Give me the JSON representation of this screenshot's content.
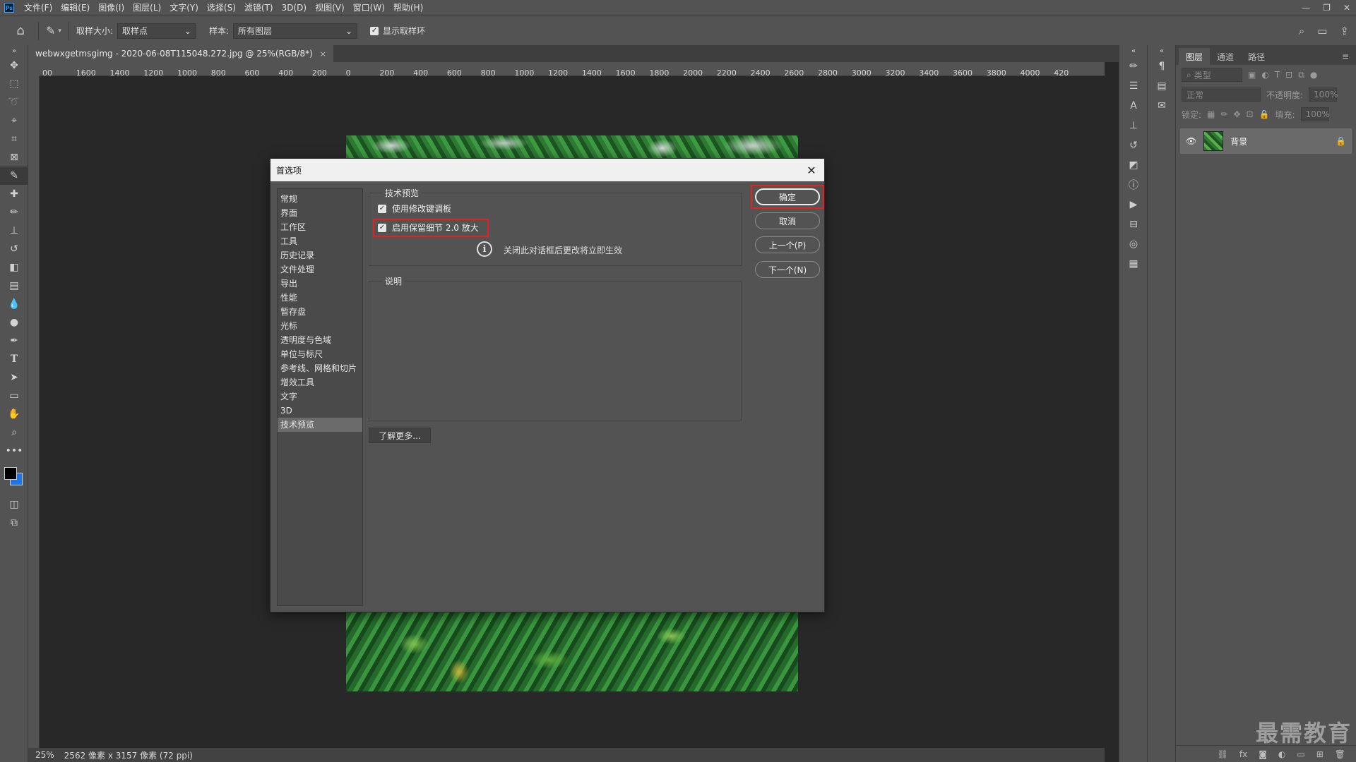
{
  "app": {
    "logo": "Ps"
  },
  "menu": [
    "文件(F)",
    "编辑(E)",
    "图像(I)",
    "图层(L)",
    "文字(Y)",
    "选择(S)",
    "滤镜(T)",
    "3D(D)",
    "视图(V)",
    "窗口(W)",
    "帮助(H)"
  ],
  "options": {
    "sample_size_label": "取样大小:",
    "sample_size_value": "取样点",
    "sample_label": "样本:",
    "sample_value": "所有图层",
    "show_ring_label": "显示取样环",
    "show_ring_checked": true
  },
  "document": {
    "tab_title": "webwxgetmsgimg - 2020-06-08T115048.272.jpg @ 25%(RGB/8*)",
    "ruler_ticks": [
      "00",
      "1600",
      "1400",
      "1200",
      "1000",
      "800",
      "600",
      "400",
      "200",
      "0",
      "200",
      "400",
      "600",
      "800",
      "1000",
      "1200",
      "1400",
      "1600",
      "1800",
      "2000",
      "2200",
      "2400",
      "2600",
      "2800",
      "3000",
      "3200",
      "3400",
      "3600",
      "3800",
      "4000",
      "420"
    ]
  },
  "status": {
    "zoom": "25%",
    "size": "2562 像素 x 3157 像素 (72 ppi)"
  },
  "layers_panel": {
    "tabs": [
      "图层",
      "通道",
      "路径"
    ],
    "filter_placeholder": "类型",
    "blend_mode": "正常",
    "opacity_label": "不透明度:",
    "opacity_value": "100%",
    "lock_label": "锁定:",
    "fill_label": "填充:",
    "fill_value": "100%",
    "layer_name": "背景"
  },
  "watermark": "最需教育",
  "dialog": {
    "title": "首选项",
    "nav": [
      "常规",
      "界面",
      "工作区",
      "工具",
      "历史记录",
      "文件处理",
      "导出",
      "性能",
      "暂存盘",
      "光标",
      "透明度与色域",
      "单位与标尺",
      "参考线、网格和切片",
      "增效工具",
      "文字",
      "3D",
      "技术预览"
    ],
    "selected_nav": "技术预览",
    "group_title": "技术预览",
    "option1": "使用修改键调板",
    "option1_checked": true,
    "option2": "启用保留细节 2.0 放大",
    "option2_checked": true,
    "info_text": "关闭此对话框后更改将立即生效",
    "description_title": "说明",
    "learn_more": "了解更多...",
    "buttons": {
      "ok": "确定",
      "cancel": "取消",
      "prev": "上一个(P)",
      "next": "下一个(N)"
    }
  },
  "colors": {
    "highlight": "#e32222",
    "accent_bg": "#1e74e8"
  }
}
